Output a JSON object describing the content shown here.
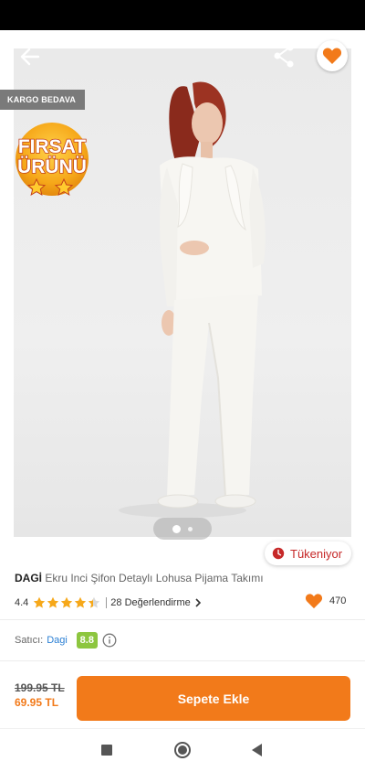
{
  "header": {
    "back_icon": "arrow-left-icon",
    "share_icon": "share-icon",
    "favorite_icon": "heart-icon"
  },
  "badges": {
    "cargo": "KARGO BEDAVA",
    "firsat_line1": "FIRSAT",
    "firsat_line2": "ÜRÜNÜ"
  },
  "gallery": {
    "image_count": 2,
    "active_index": 0
  },
  "stock": {
    "label": "Tükeniyor",
    "icon": "clock-icon"
  },
  "product": {
    "brand": "DAGİ",
    "name": "Ekru Inci Şifon Detaylı Lohusa Pijama Takımı",
    "rating": "4.4",
    "rating_value": 4.4,
    "reviews": "28 Değerlendirme",
    "favorites": "470"
  },
  "seller": {
    "label": "Satıcı:",
    "name": "Dagi",
    "score": "8.8",
    "info_icon": "info-icon"
  },
  "price": {
    "old": "199.95 TL",
    "new": "69.95 TL"
  },
  "cart": {
    "button_label": "Sepete Ekle"
  },
  "colors": {
    "accent": "#f27a1a",
    "stock_red": "#c62828",
    "seller_green": "#8dc63f",
    "seller_link": "#2a7fd4"
  },
  "system_nav": {
    "recents_icon": "square-icon",
    "home_icon": "circle-icon",
    "back_icon": "triangle-back-icon"
  }
}
